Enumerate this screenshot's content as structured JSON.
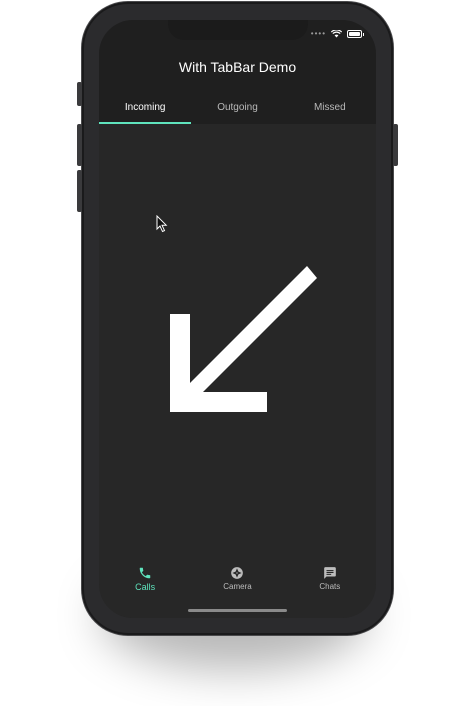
{
  "app": {
    "title": "With TabBar Demo"
  },
  "tabs": [
    {
      "label": "Incoming",
      "active": true
    },
    {
      "label": "Outgoing",
      "active": false
    },
    {
      "label": "Missed",
      "active": false
    }
  ],
  "content": {
    "icon": "call-received-arrow-icon"
  },
  "bottom_nav": [
    {
      "label": "Calls",
      "icon": "phone-icon",
      "active": true
    },
    {
      "label": "Camera",
      "icon": "camera-shutter-icon",
      "active": false
    },
    {
      "label": "Chats",
      "icon": "chat-icon",
      "active": false
    }
  ],
  "colors": {
    "accent": "#5fe3bd",
    "appbar": "#1f1f1f",
    "background": "#272727"
  }
}
